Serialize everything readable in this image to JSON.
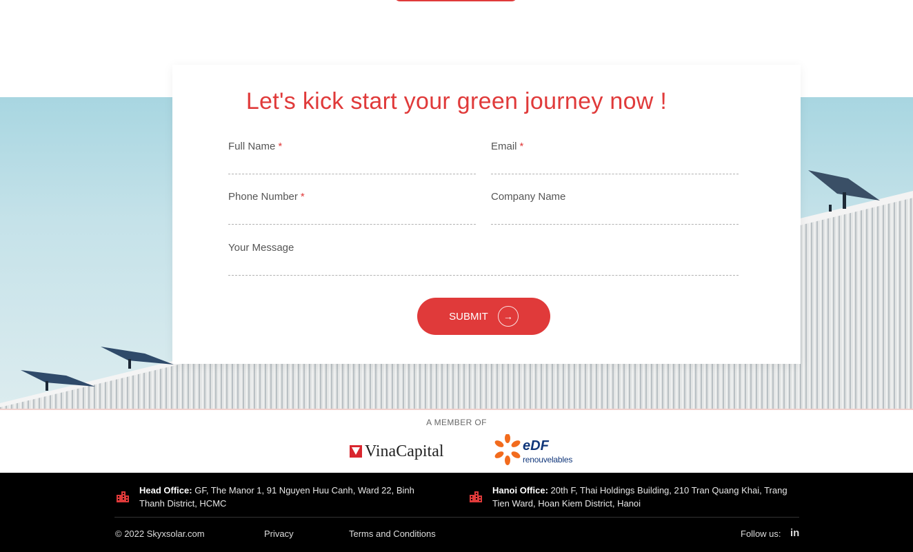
{
  "form": {
    "title": "Let's kick start your green journey now !",
    "fields": {
      "full_name": {
        "label": "Full Name",
        "required_mark": "*",
        "value": ""
      },
      "email": {
        "label": "Email",
        "required_mark": "*",
        "value": ""
      },
      "phone": {
        "label": "Phone Number",
        "required_mark": "*",
        "value": ""
      },
      "company": {
        "label": "Company Name",
        "value": ""
      },
      "message": {
        "label": "Your Message",
        "value": ""
      }
    },
    "submit_label": "SUBMIT",
    "submit_icon": "arrow-right-icon"
  },
  "members": {
    "label": "A MEMBER OF",
    "vinacapital": "VinaCapital",
    "edf": "eDF",
    "edf_sub": "renouvelables"
  },
  "footer": {
    "head_office_label": "Head Office:",
    "head_office_address": "GF, The Manor 1, 91 Nguyen Huu Canh, Ward 22, Binh Thanh District, HCMC",
    "hanoi_office_label": "Hanoi Office:",
    "hanoi_office_address": "20th F, Thai Holdings Building, 210 Tran Quang Khai, Trang Tien Ward, Hoan Kiem District, Hanoi",
    "copyright": "© 2022 Skyxsolar.com",
    "privacy": "Privacy",
    "terms": "Terms and Conditions",
    "follow": "Follow us:",
    "linkedin": "in"
  },
  "colors": {
    "accent": "#e03a3a",
    "footer_bg": "#000000"
  }
}
